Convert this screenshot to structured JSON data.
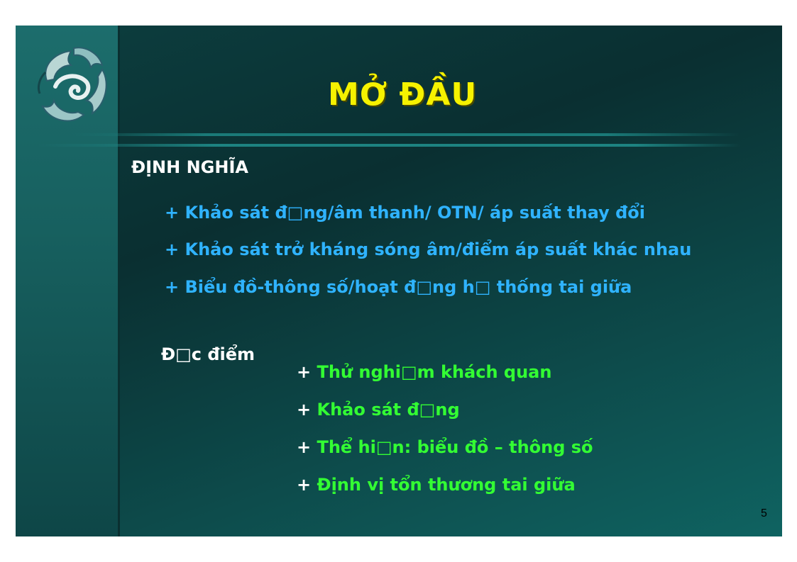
{
  "slide": {
    "title": "MỞ ĐẦU",
    "definition": {
      "heading": "ĐỊNH NGHĨA",
      "items": [
        "+ Khảo sát đ□ng/âm thanh/ OTN/ áp suất thay đổi",
        "+ Khảo sát trở kháng sóng âm/điểm áp suất khác nhau",
        "+ Biểu đồ-thông số/hoạt đ□ng h□ thống tai giữa"
      ]
    },
    "features": {
      "heading": "Đ□c điểm",
      "items": [
        {
          "plus": "+",
          "text": "Thử nghi□m khách quan"
        },
        {
          "plus": "+",
          "text": "Khảo sát đ□ng"
        },
        {
          "plus": "+",
          "text": "Thể hi□n: biểu đồ – thông số"
        },
        {
          "plus": "+",
          "text": "Định vị tổn thương tai giữa"
        }
      ]
    },
    "page_number": "5"
  },
  "colors": {
    "title": "#f6f200",
    "definition_text": "#2fb3ff",
    "feature_text": "#33ff33",
    "heading_text": "#ffffff"
  },
  "icons": {
    "logo": "dolphin-logo-icon"
  }
}
